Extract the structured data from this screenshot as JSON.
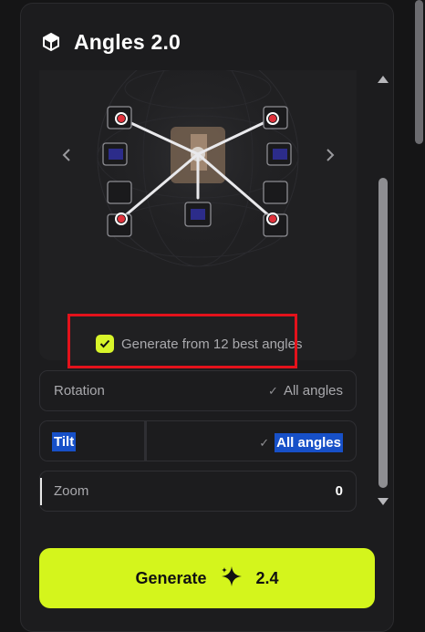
{
  "header": {
    "title": "Angles 2.0",
    "icon": "cube-icon"
  },
  "preview": {
    "nav_left": "chevron-left-icon",
    "nav_right": "chevron-right-icon",
    "option": {
      "label": "Generate from 12 best angles",
      "checked": true
    }
  },
  "settings": [
    {
      "label": "Rotation",
      "value": "All angles",
      "check": "✓"
    },
    {
      "label": "Tilt",
      "value": "All angles",
      "check": "✓"
    },
    {
      "label": "Zoom",
      "value": "0"
    }
  ],
  "generate": {
    "label": "Generate",
    "cost": "2.4",
    "icon": "sparkle-icon"
  },
  "colors": {
    "accent": "#d4f51c",
    "highlight": "#e3121b",
    "panel": "#1c1c1e",
    "selection": "#1750c8"
  }
}
